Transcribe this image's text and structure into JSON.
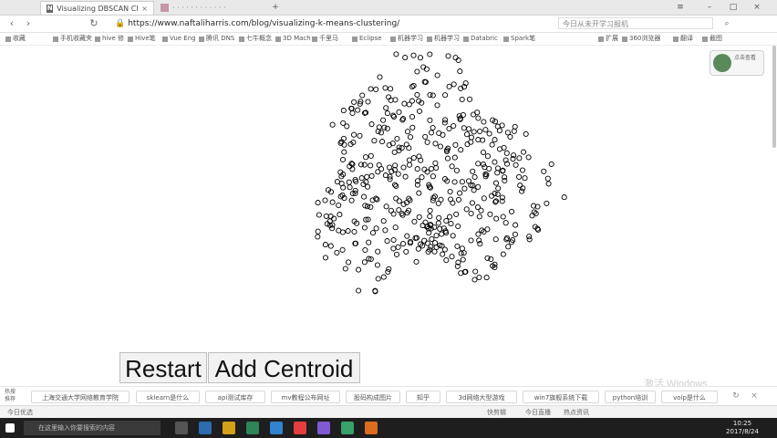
{
  "browser": {
    "tabs": [
      {
        "label": "Visualizing DBSCAN Cluster",
        "favicon": "N",
        "active": true
      },
      {
        "label": "· · · · · · · · · · · ·",
        "active": false
      }
    ],
    "url": "https://www.naftaliharris.com/blog/visualizing-k-means-clustering/",
    "search_placeholder": "今日从未开学习报机",
    "bookmarks": [
      "收藏",
      "手机收藏夹",
      "hive 修",
      "Hive笔",
      "Vue Eng",
      "腾讯 DNS",
      "七牛概念",
      "3D Mach",
      "千里马",
      "Eclipse",
      "机器学习",
      "机器学习",
      "Databric",
      "Spark笔",
      "扩展",
      "360浏览器",
      "翻译",
      "截图"
    ],
    "side_widget_label": "点击查看"
  },
  "actions": {
    "restart_label": "Restart",
    "add_centroid_label": "Add Centroid"
  },
  "watermark": "激活 Windows",
  "hot_search": {
    "label": "热搜推荐",
    "items": [
      "上海交通大学网络教育学院",
      "sklearn是什么",
      "api测试库存",
      "mv教程公布网址",
      "股码构成图片",
      "知乎",
      "3d网络大型游戏",
      "win7旗舰系统下载",
      "python培训",
      "voip是什么"
    ]
  },
  "status_bar": {
    "left": "今日优选",
    "items": [
      "快剪辑",
      "今日直播",
      "热点资讯"
    ]
  },
  "taskbar": {
    "search_placeholder": "在这里输入你要搜索的内容",
    "time": "10:25",
    "date": "2017/8/24"
  },
  "scatter": {
    "point_count": 480,
    "point_style": "hollow black circles"
  }
}
